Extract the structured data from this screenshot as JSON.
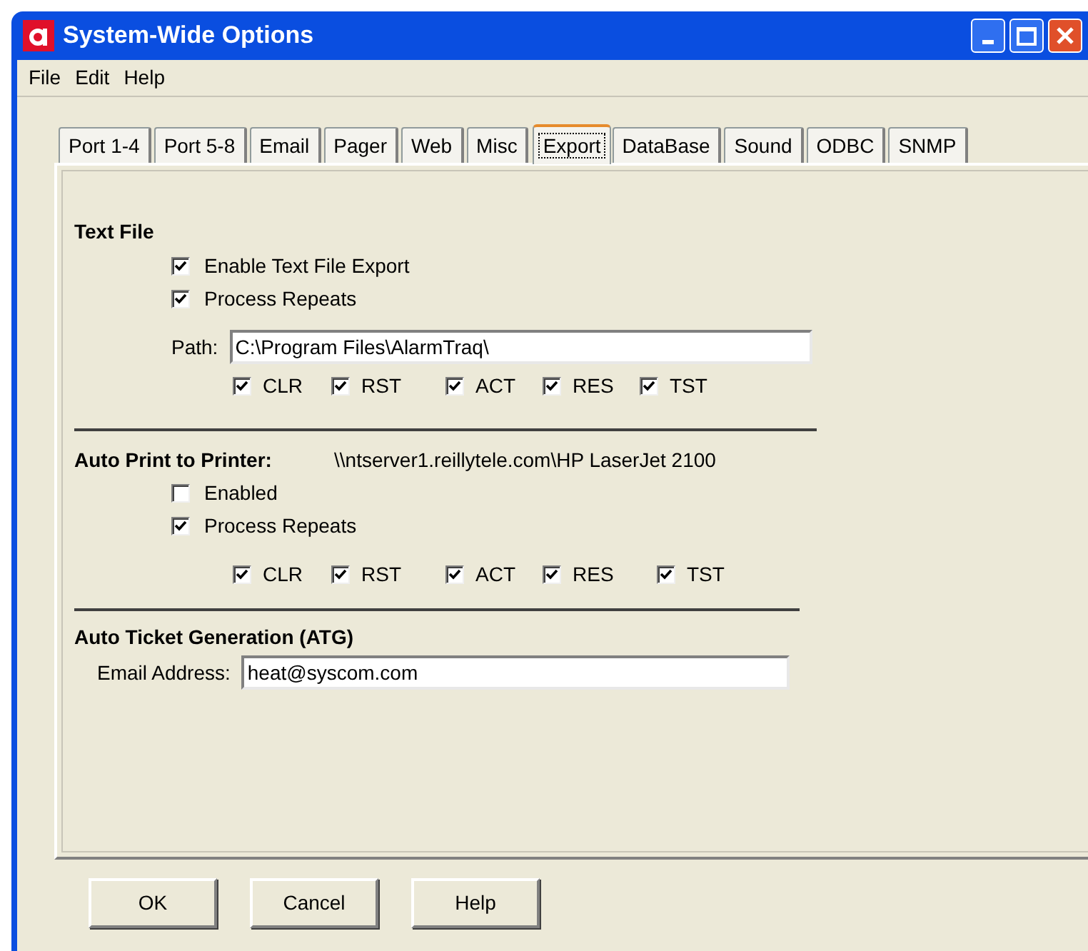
{
  "window": {
    "title": "System-Wide Options"
  },
  "menu": [
    "File",
    "Edit",
    "Help"
  ],
  "tabs": [
    {
      "label": "Port 1-4",
      "selected": false
    },
    {
      "label": "Port 5-8",
      "selected": false
    },
    {
      "label": "Email",
      "selected": false
    },
    {
      "label": "Pager",
      "selected": false
    },
    {
      "label": "Web",
      "selected": false
    },
    {
      "label": "Misc",
      "selected": false
    },
    {
      "label": "Export",
      "selected": true
    },
    {
      "label": "DataBase",
      "selected": false
    },
    {
      "label": "Sound",
      "selected": false
    },
    {
      "label": "ODBC",
      "selected": false
    },
    {
      "label": "SNMP",
      "selected": false
    }
  ],
  "text_file": {
    "heading": "Text File",
    "options": [
      {
        "label": "Enable Text File Export",
        "checked": true
      },
      {
        "label": "Process Repeats",
        "checked": true
      }
    ],
    "path_label": "Path:",
    "path_value": "C:\\Program Files\\AlarmTraq\\",
    "types": [
      {
        "label": "CLR",
        "checked": true
      },
      {
        "label": "RST",
        "checked": true
      },
      {
        "label": "ACT",
        "checked": true
      },
      {
        "label": "RES",
        "checked": true
      },
      {
        "label": "TST",
        "checked": true
      }
    ]
  },
  "auto_print": {
    "heading": "Auto Print to Printer:",
    "printer": "\\\\ntserver1.reillytele.com\\HP LaserJet 2100",
    "options": [
      {
        "label": "Enabled",
        "checked": false
      },
      {
        "label": "Process Repeats",
        "checked": true
      }
    ],
    "types": [
      {
        "label": "CLR",
        "checked": true
      },
      {
        "label": "RST",
        "checked": true
      },
      {
        "label": "ACT",
        "checked": true
      },
      {
        "label": "RES",
        "checked": true
      },
      {
        "label": "TST",
        "checked": true
      }
    ]
  },
  "atg": {
    "heading": "Auto Ticket Generation (ATG)",
    "email_label": "Email Address:",
    "email_value": "heat@syscom.com"
  },
  "buttons": [
    "OK",
    "Cancel",
    "Help"
  ]
}
